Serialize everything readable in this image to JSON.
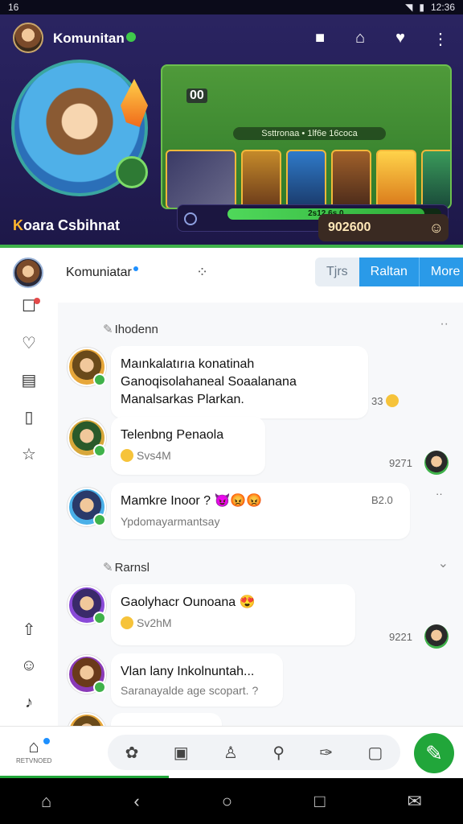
{
  "status_bar": {
    "left": "16",
    "time": "12:36"
  },
  "header": {
    "title": "Komunitan",
    "hero_name_k": "K",
    "hero_name_rest": "oara Csbihnat",
    "game_level": "00",
    "game_banner": "Ssttronaa • 1lf6e 16coca",
    "progress_label": "2s12 6s.0",
    "progress_pct": 92,
    "score": "902600"
  },
  "subheader": {
    "name": "Komuniatar",
    "tabs": [
      "Tjrs",
      "Raltan",
      "More"
    ]
  },
  "feed": {
    "section1": "Ihodenn",
    "section2": "Rarnsl",
    "messages": [
      {
        "text": "Maınkalatırıa konatinah Ganoqisolahaneal Soaalanana Manalsarkas Plarkan.",
        "meta": "33"
      },
      {
        "text": "Telenbng Penaola",
        "sub": "Svs4M",
        "meta": "9271"
      },
      {
        "text": "Mamkre Inoor ?",
        "sub": "Ypdomayarmantsay",
        "meta": "B2.0"
      },
      {
        "text": "Gaolyhacr Ounoana",
        "sub": "Sv2hM",
        "meta": "9221"
      },
      {
        "text": "Vlan lany Inkolnuntah...",
        "sub": "Saranayalde age scopart. ?"
      }
    ]
  },
  "bottom_nav": {
    "home_label": "RETVNOED"
  },
  "colors": {
    "accent": "#21a63a",
    "tab_active": "#2a9ae8",
    "header_bg": "#2a2461"
  }
}
